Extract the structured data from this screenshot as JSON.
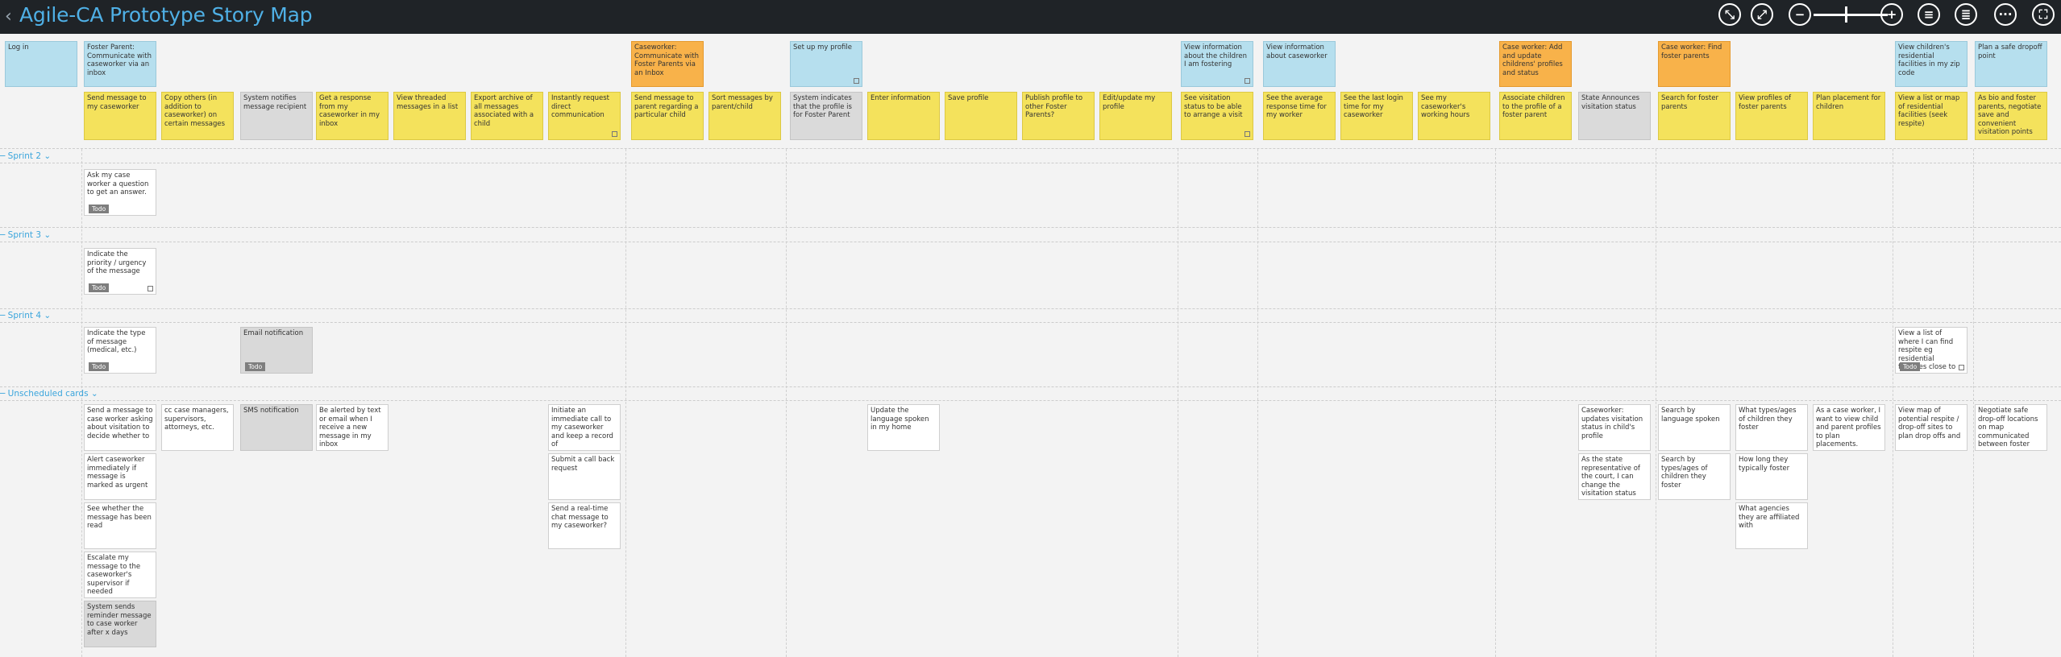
{
  "app": {
    "title": "Agile-CA Prototype Story Map",
    "toolbar": [
      {
        "name": "collapse-icon",
        "label": "⤡"
      },
      {
        "name": "expand-icon",
        "label": "⤢"
      },
      {
        "name": "zoom-out-icon",
        "label": "−"
      },
      {
        "name": "zoom-in-icon",
        "label": "+"
      },
      {
        "name": "menu-icon",
        "label": "≡"
      },
      {
        "name": "notes-icon",
        "label": "≣"
      },
      {
        "name": "more-icon",
        "label": "···"
      },
      {
        "name": "fullscreen-icon",
        "label": "⛶"
      }
    ]
  },
  "activities": [
    {
      "label": "Log in",
      "color": "blue"
    },
    {
      "label": "Foster Parent: Communicate with caseworker via an inbox",
      "color": "blue"
    },
    {
      "label": "Caseworker: Communicate with Foster Parents via an Inbox",
      "color": "orange"
    },
    {
      "label": "Set up my profile",
      "color": "blue"
    },
    {
      "label": "View information about the children I am fostering",
      "color": "blue"
    },
    {
      "label": "View information about caseworker",
      "color": "blue"
    },
    {
      "label": "Case worker: Add and update childrens' profiles and status",
      "color": "orange"
    },
    {
      "label": "Case worker: Find foster parents",
      "color": "orange"
    },
    {
      "label": "View children's residential facilities in my zip code",
      "color": "blue"
    },
    {
      "label": "Plan a safe dropoff point",
      "color": "blue"
    }
  ],
  "tasks": [
    "Send message to my caseworker",
    "Copy others (in addition to caseworker) on certain messages",
    "System notifies message recipient",
    "Get a response from my caseworker in my inbox",
    "View threaded messages in a list",
    "Export archive of all messages associated with a child",
    "Instantly request direct communication",
    "Send message to parent regarding a particular child",
    "Sort messages by parent/child",
    "System indicates that the profile is for Foster Parent",
    "Enter information",
    "Save profile",
    "Publish profile to other Foster Parents?",
    "Edit/update my profile",
    "See visitation status to be able to arrange a visit",
    "See the average response time for my worker",
    "See the last login time for my caseworker",
    "See my caseworker's working hours",
    "Associate children to the profile of a foster parent",
    "State Announces visitation status",
    "Search for foster parents",
    "View profiles of foster parents",
    "Plan placement for children",
    "View a list or map of residential facilities (seek respite)",
    "As bio and foster parents, negotiate save and convenient visitation points"
  ],
  "lanes": [
    "Sprint 2",
    "Sprint 3",
    "Sprint 4",
    "Unscheduled cards"
  ],
  "status_label": "Todo",
  "stories": {
    "sprint2": [
      "Ask my case worker a question to get an answer."
    ],
    "sprint3": [
      "Indicate the priority / urgency of the message"
    ],
    "sprint4": [
      "Indicate the type of message (medical, etc.)",
      "Email notification",
      "View a list of where I can find respite eg residential facilities close to me"
    ],
    "unscheduled": [
      "Send a message to case worker asking about visitation to decide whether to",
      "Alert caseworker immediately if message is marked as urgent",
      "See whether the message has been read",
      "Escalate my message to the caseworker's supervisor if needed",
      "System sends reminder message to case worker after x days",
      "cc case managers, supervisors, attorneys, etc.",
      "SMS notification",
      "Be alerted by text or email when I receive a new message in my inbox",
      "Initiate an immediate call to my caseworker and keep a record of",
      "Submit a call back request",
      "Send a real-time chat message to my caseworker?",
      "Update the language spoken in my home",
      "Caseworker: updates visitation status in child's profile",
      "As the state representative of the court, I can change the visitation status",
      "Search by language spoken",
      "Search by types/ages of children they foster",
      "What types/ages of children they foster",
      "How long they typically foster",
      "What agencies they are affiliated with",
      "As a case worker, I want to view child and parent profiles to plan placements.",
      "View map of potential respite / drop-off sites to plan drop offs and",
      "Negotiate safe drop-off locations on map communicated between foster"
    ]
  }
}
